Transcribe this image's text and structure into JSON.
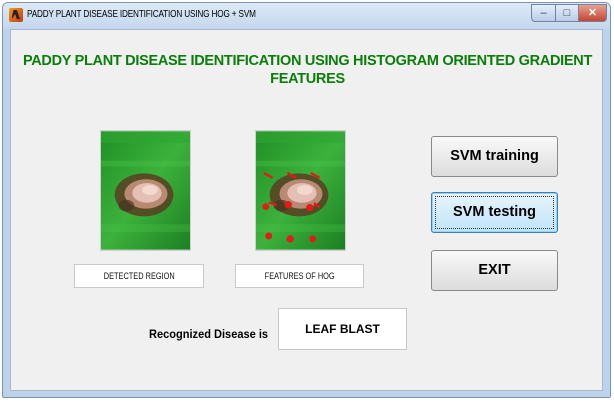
{
  "window": {
    "title": "PADDY PLANT DISEASE IDENTIFICATION USING HOG + SVM",
    "controls": {
      "minimize": "–",
      "maximize": "□",
      "close": "✕"
    }
  },
  "heading": {
    "line1": "PADDY PLANT DISEASE IDENTIFICATION USING HISTOGRAM ORIENTED GRADIENT",
    "line2": "FEATURES",
    "color": "#0a7d0a"
  },
  "panels": {
    "detected_region_label": "DETECTED REGION",
    "hog_features_label": "FEATURES OF HOG"
  },
  "buttons": {
    "svm_training": "SVM training",
    "svm_testing": "SVM testing",
    "exit": "EXIT"
  },
  "result": {
    "label": "Recognized Disease is",
    "value": "LEAF BLAST"
  },
  "colors": {
    "leaf_green": "#2f9a2f",
    "hog_marker": "#e31b1b"
  }
}
